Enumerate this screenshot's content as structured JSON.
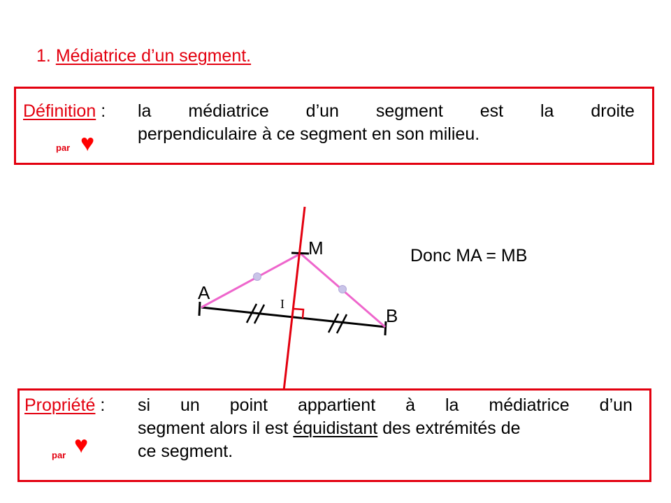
{
  "title": {
    "number": "1.",
    "text": "Médiatrice d’un segment."
  },
  "definition": {
    "label": "Définition",
    "colon": ":",
    "par": "par",
    "heart": "♥",
    "line1_words": [
      "la",
      "médiatrice",
      "d’un",
      "segment",
      "est",
      "la",
      "droite"
    ],
    "line2": "perpendiculaire à ce segment en son milieu."
  },
  "diagram": {
    "points": {
      "A": "A",
      "B": "B",
      "M": "M",
      "I": "I"
    },
    "colors": {
      "bisector": "#e3000f",
      "equal_segments": "#ee66cc",
      "segment": "#000000",
      "marker_fill": "#c9c4e8"
    },
    "conclusion": "Donc MA = MB"
  },
  "property": {
    "label": "Propriété",
    "colon": ":",
    "par": "par",
    "heart": "♥",
    "line1_words": [
      "si",
      "un",
      "point",
      "appartient",
      "à",
      "la",
      "médiatrice",
      "d’un"
    ],
    "line2_before": "segment alors il est",
    "line2_underlined": "équidistant",
    "line2_after": "des extrémités de",
    "line3": "ce segment."
  }
}
